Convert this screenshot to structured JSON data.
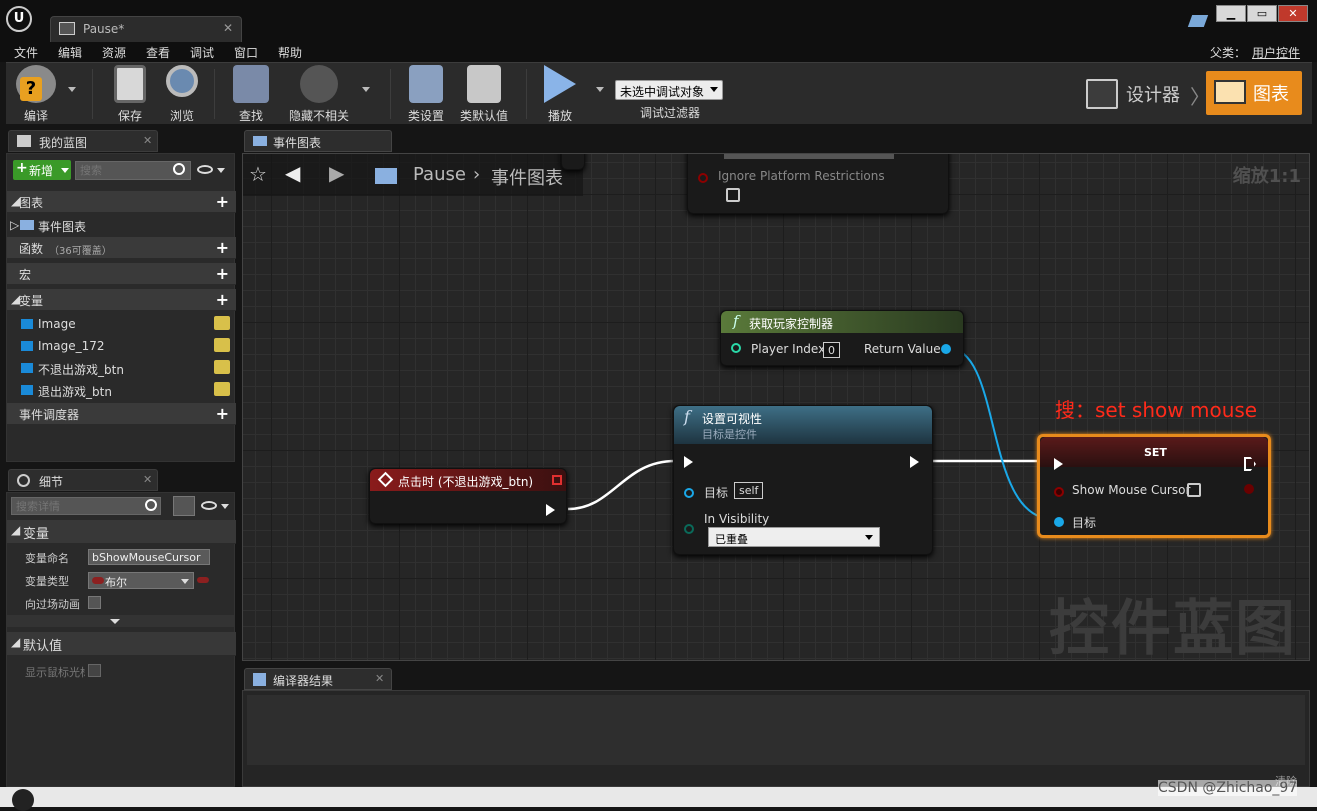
{
  "window": {
    "doc_tab": "Pause*",
    "controls": [
      "▁",
      "▭",
      "✕"
    ]
  },
  "menu": [
    "文件",
    "编辑",
    "资源",
    "查看",
    "调试",
    "窗口",
    "帮助"
  ],
  "parent": {
    "label": "父类：",
    "value": "用户控件"
  },
  "toolbar": {
    "compile": "编译",
    "save": "保存",
    "browse": "浏览",
    "find": "查找",
    "hide_unrelated": "隐藏不相关",
    "class_settings": "类设置",
    "class_defaults": "类默认值",
    "play": "播放",
    "debug_object": "未选中调试对象",
    "debug_filter": "调试过滤器",
    "designer": "设计器",
    "graph": "图表"
  },
  "my_blueprint": {
    "tab": "我的蓝图",
    "new_button": "新增",
    "search_placeholder": "搜索",
    "sections": {
      "graphs": "图表",
      "event_graph": "事件图表",
      "functions": "函数",
      "functions_overridable": "（36可覆盖）",
      "macros": "宏",
      "variables": "变量",
      "event_dispatchers": "事件调度器"
    },
    "variables": [
      "Image",
      "Image_172",
      "不退出游戏_btn",
      "退出游戏_btn"
    ]
  },
  "details": {
    "tab": "细节",
    "search_placeholder": "搜索详情",
    "section_variable": "变量",
    "var_name_label": "变量命名",
    "var_name_value": "bShowMouseCursor",
    "var_type_label": "变量类型",
    "var_type_value": "布尔",
    "transition_label": "向过场动画",
    "section_default": "默认值",
    "default_label": "显示鼠标光标"
  },
  "graph": {
    "tab": "事件图表",
    "crumb_root": "Pause",
    "crumb_leaf": "事件图表",
    "zoom": "缩放1:1",
    "watermark": "控件蓝图",
    "annotation": "搜：set show mouse",
    "ignore_node_label": "Ignore Platform Restrictions",
    "get_pc": {
      "title": "获取玩家控制器",
      "player_index": "Player Index",
      "player_index_value": "0",
      "return_value": "Return Value"
    },
    "set_vis": {
      "title": "设置可视性",
      "subtitle": "目标是控件",
      "target": "目标",
      "target_value": "self",
      "in_visibility": "In Visibility",
      "visibility_value": "已重叠"
    },
    "event": {
      "title": "点击时 (不退出游戏_btn)"
    },
    "set_node": {
      "title": "SET",
      "show_cursor": "Show Mouse Cursor",
      "target": "目标"
    }
  },
  "compiler": {
    "tab": "编译器结果",
    "clear": "清除"
  },
  "footer": {
    "watermark": "CSDN @Zhichao_97"
  },
  "colors": {
    "accent": "#e88b1c",
    "exec": "#ffffff",
    "object_pin": "#1aa8e8",
    "bool_pin": "#8c0000",
    "annotation": "#ff2a1a",
    "event_header": "#8a1b1b",
    "function_header": "#3e6f86",
    "pure_header": "#5a7a3a"
  }
}
